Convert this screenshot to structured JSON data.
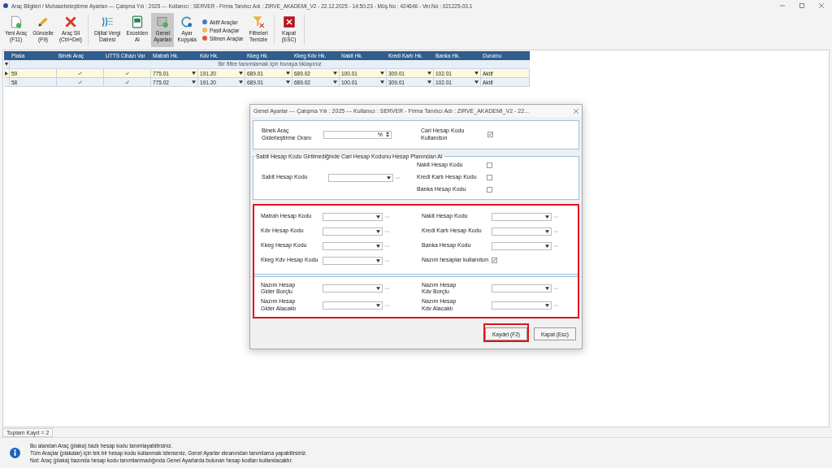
{
  "window": {
    "title": "Araç Bilgileri / Muhasebeleştirme Ayarları --- Çalışma Yılı : 2025 --- Kullanıcı : SERVER - Firma Tanıtıcı Adı : ZIRVE_AKADEMI_V2 - 22.12.2025 - 14:50:23 - Müş.No : 424646 - Ver.No : 021225-03.1"
  },
  "toolbar": [
    {
      "kind": "button",
      "lines": [
        "Yeni Araç",
        "(F11)"
      ],
      "selected": false
    },
    {
      "kind": "button",
      "lines": [
        "Güncelle",
        "(F9)"
      ],
      "selected": false
    },
    {
      "kind": "button",
      "lines": [
        "Araç Sil",
        "(Ctrl+Del)"
      ],
      "selected": false
    },
    {
      "kind": "separator"
    },
    {
      "kind": "button",
      "lines": [
        "Dijital Vergi",
        "Dairesi"
      ],
      "selected": false
    },
    {
      "kind": "button",
      "lines": [
        "Excelden",
        "Al"
      ],
      "selected": false
    },
    {
      "kind": "button",
      "lines": [
        "Genel",
        "Ayarları"
      ],
      "selected": true
    },
    {
      "kind": "button",
      "lines": [
        "Ayar",
        "Kopyala"
      ],
      "selected": false
    },
    {
      "kind": "legend",
      "entries": [
        {
          "label": "Aktif Araçlar",
          "color": "#3a7bd5"
        },
        {
          "label": "Pasif Araçlar",
          "color": "#f0b860"
        },
        {
          "label": "Silinen Araçlar",
          "color": "#e0533a"
        }
      ]
    },
    {
      "kind": "button",
      "lines": [
        "Filtreleri",
        "Temizle"
      ],
      "selected": false
    },
    {
      "kind": "separator"
    },
    {
      "kind": "button",
      "lines": [
        "Kapat",
        "(ESC)"
      ],
      "selected": false
    },
    {
      "kind": "separator"
    }
  ],
  "grid": {
    "columns": [
      "Plaka",
      "Binek Araç",
      "UTTS Cihazı Var",
      "Matrah Hk.",
      "Kdv Hk.",
      "Kkeg Hk.",
      "Kkeg Kdv Hk.",
      "Nakit Hk.",
      "Kredi Kartı Hk.",
      "Banka Hk.",
      "Durumu"
    ],
    "filter_hint": "Bir filtre tanımlamak için buraya tıklayınız",
    "rows": [
      {
        "selected": true,
        "plaka": "59",
        "binek_arac": true,
        "utts": true,
        "accounts": [
          "775.01",
          "191.20",
          "689.01",
          "689.02",
          "100.01",
          "309.01",
          "102.01"
        ],
        "durumu": "Aktif"
      },
      {
        "selected": false,
        "plaka": "58",
        "binek_arac": true,
        "utts": true,
        "accounts": [
          "775.02",
          "191.20",
          "689.01",
          "689.02",
          "100.01",
          "309.01",
          "102.01"
        ],
        "durumu": "Aktif"
      }
    ],
    "total": "Toplam Kayıt = 2"
  },
  "info": [
    "Bu alandan Araç (plaka) bazlı hesap kodu tanımlayabilirsiniz.",
    "Tüm Araçlar (plakalar) için tek bir hesap kodu kullanmak isterseniz, Genel Ayarlar ekranından tanımlama yapabilirsiniz.",
    "Not: Araç (plaka) bazında hesap kodu tanımlanmadığında Genel Ayarlarda bulunan hesap kodları kullanılacaktır."
  ],
  "dialog": {
    "title": "Genel Ayarlar --- Çalışma Yılı : 2025 --- Kullanıcı : SERVER - Firma Tanıtıcı Adı : ZIRVE_AKADEMI_V2 - 22...",
    "rate_label": "Binek Araç Giderleştirme Oranı",
    "rate_value": "%",
    "cari_label": "Cari Hesap Kodu Kullanılsın",
    "cari_checked": true,
    "fallback": {
      "legend": "Sabit Hesap Kodu Girilmediğinde Cari Hesap Kodunu Hesap Planından Al",
      "field_label": "Sabit Hesap Kodu",
      "checks": [
        {
          "label": "Nakit Hesap Kodu",
          "checked": false
        },
        {
          "label": "Kredi Kartı Hesap Kodu",
          "checked": false
        },
        {
          "label": "Banka Hesap Kodu",
          "checked": false
        }
      ]
    },
    "accounts": {
      "highlighted": true,
      "left": [
        "Matrah Hesap Kodu",
        "Kdv Hesap Kodu",
        "Kkeg Hesap Kodu",
        "Kkeg Kdv Hesap Kodu"
      ],
      "right": [
        "Nakit Hesap Kodu",
        "Kredi Kartı Hesap Kodu",
        "Banka Hesap Kodu"
      ],
      "nazim_label": "Nazım hesaplar kullanılsın",
      "nazim_checked": true,
      "nazim_fields": [
        {
          "lines": [
            "Nazım Hesap",
            "Gider Borçlu"
          ]
        },
        {
          "lines": [
            "Nazım Hesap",
            "Kdv Borçlu"
          ]
        },
        {
          "lines": [
            "Nazım Hesap",
            "Gider Alacaklı"
          ]
        },
        {
          "lines": [
            "Nazım Hesap",
            "Kdv Alacaklı"
          ]
        }
      ]
    },
    "buttons": [
      {
        "label": "Kaydet (F2)",
        "highlighted": true
      },
      {
        "label": "Kapat (Esc)",
        "highlighted": false
      }
    ]
  }
}
